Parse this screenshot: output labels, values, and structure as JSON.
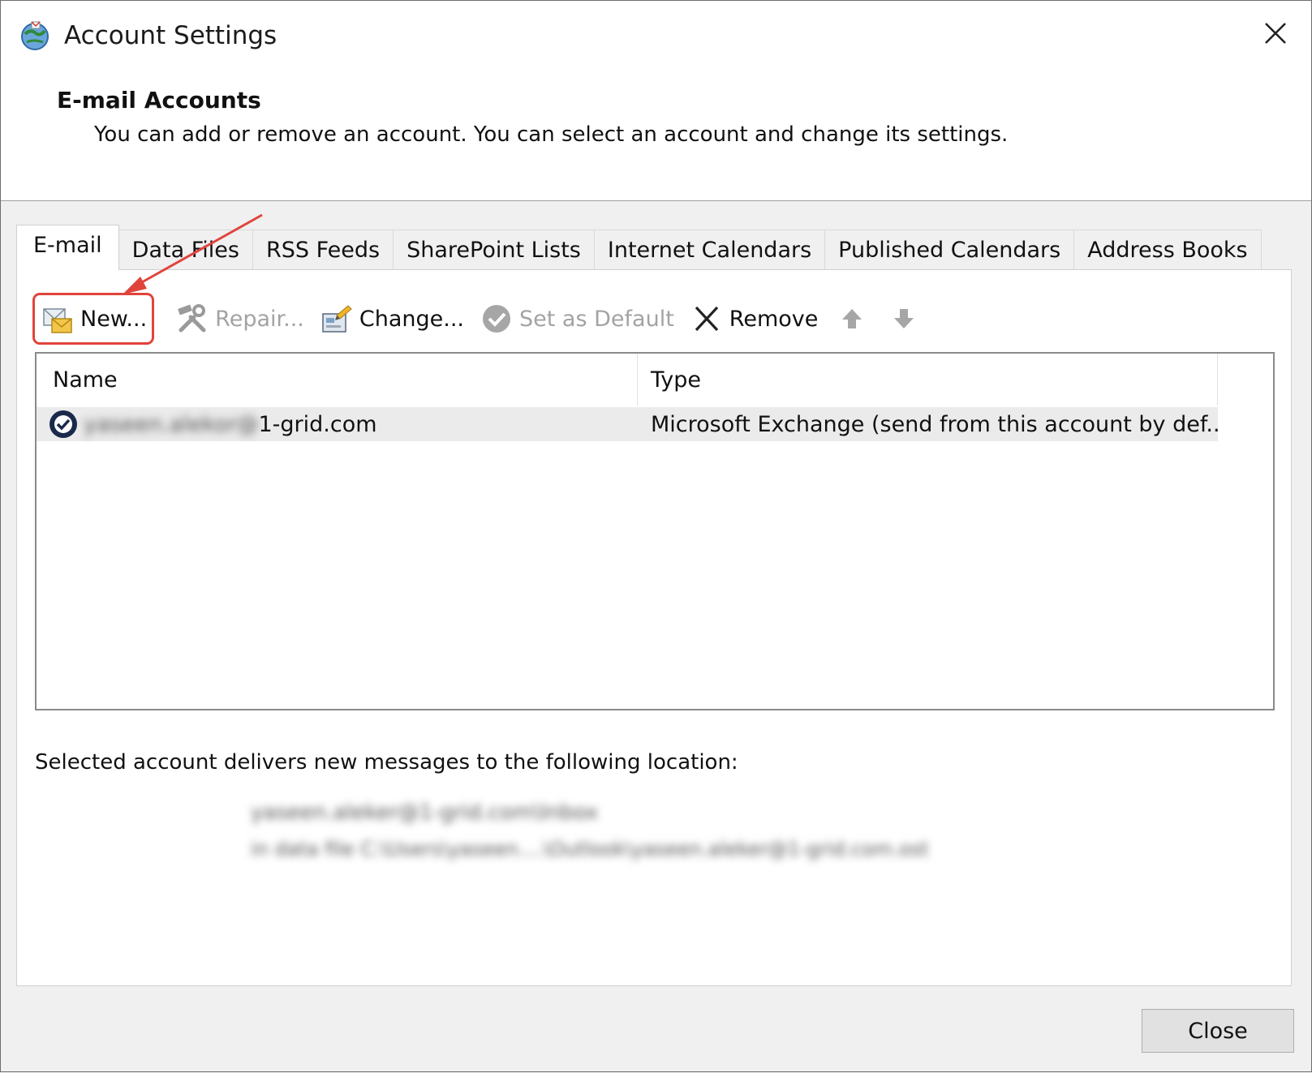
{
  "window": {
    "title": "Account Settings"
  },
  "header": {
    "title": "E-mail Accounts",
    "description": "You can add or remove an account. You can select an account and change its settings."
  },
  "tabs": [
    {
      "label": "E-mail",
      "active": true
    },
    {
      "label": "Data Files"
    },
    {
      "label": "RSS Feeds"
    },
    {
      "label": "SharePoint Lists"
    },
    {
      "label": "Internet Calendars"
    },
    {
      "label": "Published Calendars"
    },
    {
      "label": "Address Books"
    }
  ],
  "toolbar": {
    "new_label": "New...",
    "repair_label": "Repair...",
    "change_label": "Change...",
    "set_default_label": "Set as Default",
    "remove_label": "Remove"
  },
  "accounts_list": {
    "columns": {
      "name": "Name",
      "type": "Type"
    },
    "rows": [
      {
        "name_redacted": "yaseen.alekor@",
        "name_visible": "1-grid.com",
        "type": "Microsoft Exchange (send from this account by def..."
      }
    ]
  },
  "delivery": {
    "label": "Selected account delivers new messages to the following location:",
    "location_redacted": "yaseen.aleker@1-grid.com\\Inbox",
    "datafile_redacted": "in data file C:\\Users\\yaseen....\\Outlook\\yaseen.aleker@1-grid.com.ost"
  },
  "footer": {
    "close_label": "Close"
  },
  "colors": {
    "annotation_red": "#e0443c",
    "selected_row": "#ebebeb"
  }
}
